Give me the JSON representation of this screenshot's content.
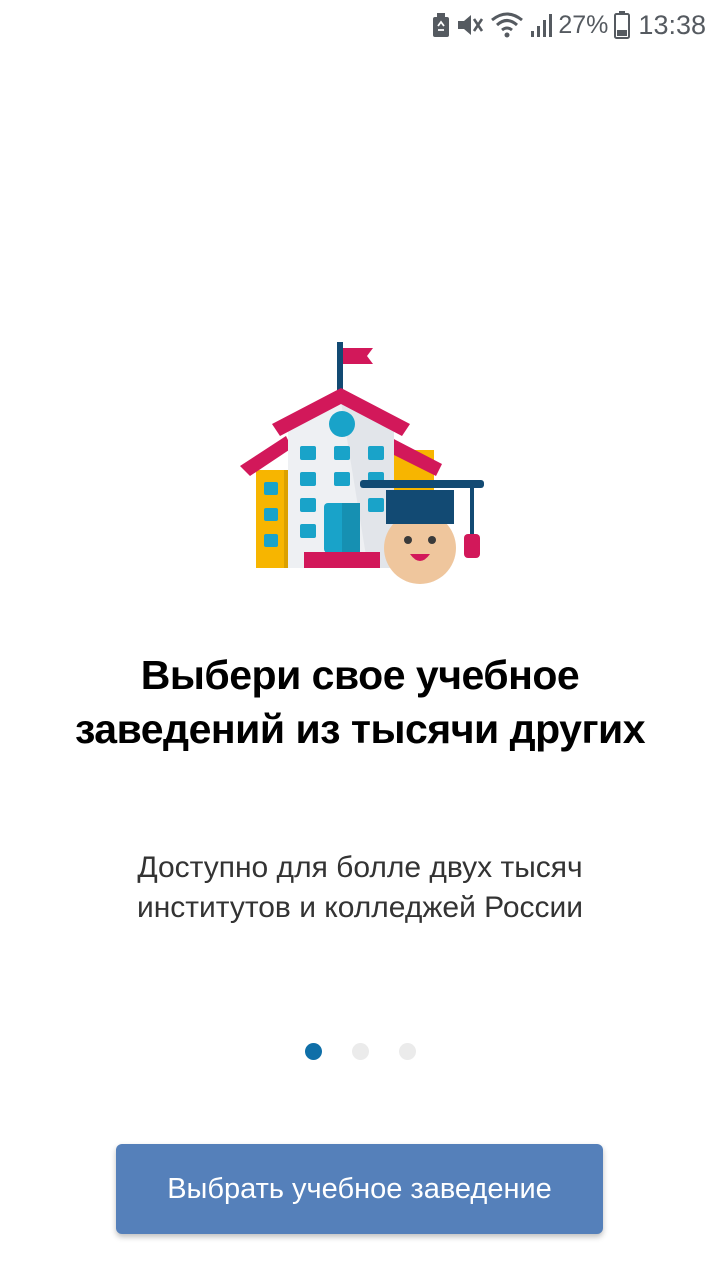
{
  "status_bar": {
    "battery_percent": "27%",
    "time": "13:38",
    "icons": [
      "trash-icon",
      "mute-icon",
      "wifi-icon",
      "signal-icon",
      "battery-icon"
    ]
  },
  "onboarding": {
    "illustration": "school-with-graduate-icon",
    "title": "Выбери свое учебное заведений из тысячи других",
    "subtitle": "Доступно для болле двух тысяч институтов и колледжей России",
    "pager": {
      "count": 3,
      "active_index": 0
    },
    "button_label": "Выбрать учебное заведение"
  },
  "colors": {
    "button": "#5580ba",
    "dot_active": "#0f6fa8",
    "dot_inactive": "#ebebeb",
    "roof": "#d2185a",
    "wing": "#f7b500",
    "windows": "#19a3c9",
    "cap": "#124a73",
    "face": "#efc69d"
  }
}
